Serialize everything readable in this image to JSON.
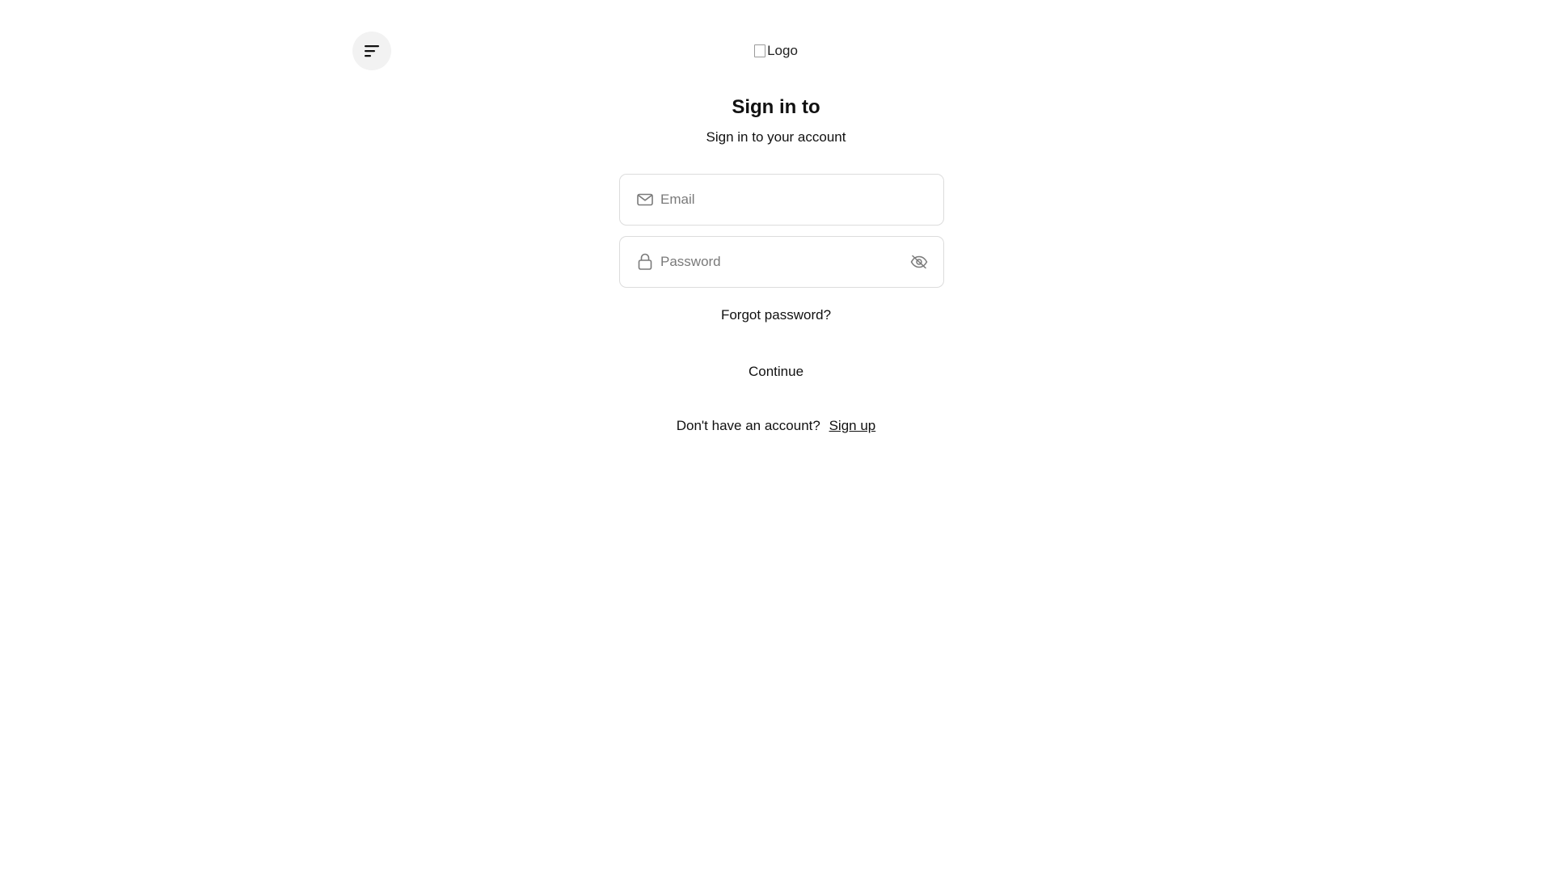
{
  "header": {
    "menu_icon": "menu-lines-icon",
    "logo_alt": "Logo",
    "logo_icon": "broken-image-icon"
  },
  "auth": {
    "title": "Sign in to",
    "subtitle": "Sign in to your account"
  },
  "form": {
    "email": {
      "placeholder": "Email",
      "value": "",
      "icon": "mail-icon"
    },
    "password": {
      "placeholder": "Password",
      "value": "",
      "icon": "lock-icon",
      "toggle_icon": "eye-off-icon"
    },
    "forgot_label": "Forgot password?",
    "continue_label": "Continue"
  },
  "footer": {
    "prompt": "Don't have an account?",
    "signup_label": "Sign up"
  },
  "colors": {
    "background": "#ffffff",
    "menu_button_bg": "#f2f2f2",
    "field_border": "#dcdcdc",
    "placeholder": "#7a7a7a",
    "text": "#111111"
  }
}
